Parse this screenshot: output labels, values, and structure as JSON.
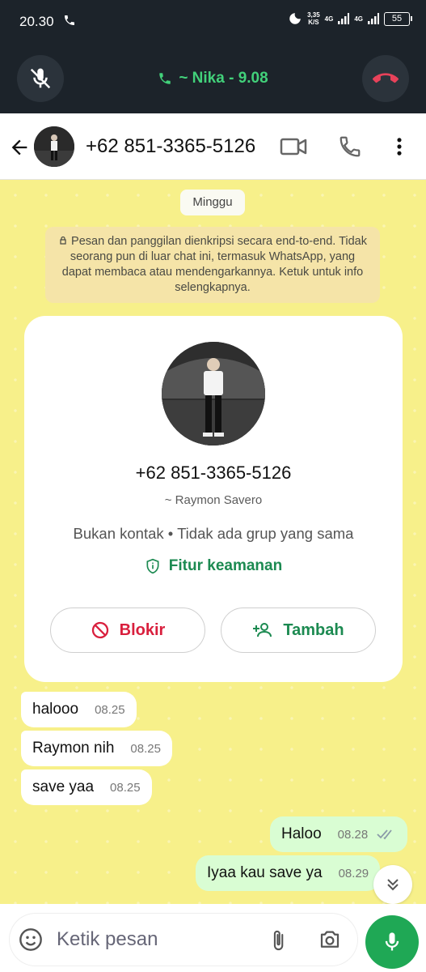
{
  "status_bar": {
    "time": "20.30",
    "speed_value": "3,35",
    "speed_unit": "K/S",
    "net1": "4G",
    "net2": "4G",
    "battery": "55"
  },
  "call_bar": {
    "title": "~ Nika - 9.08"
  },
  "header": {
    "title": "+62 851-3365-5126"
  },
  "chat": {
    "day_chip": "Minggu",
    "encryption_notice": "Pesan dan panggilan dienkripsi secara end-to-end. Tidak seorang pun di luar chat ini, termasuk WhatsApp, yang dapat membaca atau mendengarkannya. Ketuk untuk info selengkapnya.",
    "contact_card": {
      "number": "+62 851-3365-5126",
      "name": "~ Raymon Savero",
      "meta": "Bukan kontak • Tidak ada grup yang sama",
      "security_label": "Fitur keamanan",
      "block_label": "Blokir",
      "add_label": "Tambah"
    },
    "messages": [
      {
        "dir": "in",
        "text": "halooo",
        "time": "08.25"
      },
      {
        "dir": "in",
        "text": "Raymon nih",
        "time": "08.25"
      },
      {
        "dir": "in",
        "text": "save yaa",
        "time": "08.25"
      },
      {
        "dir": "out",
        "text": "Haloo",
        "time": "08.28"
      },
      {
        "dir": "out",
        "text": "Iyaa kau save ya",
        "time": "08.29"
      }
    ]
  },
  "composer": {
    "placeholder": "Ketik pesan"
  },
  "colors": {
    "accent": "#1fa855",
    "chat_bg": "#f7f08a",
    "call_green": "#42d17a",
    "danger": "#d91f3d"
  }
}
